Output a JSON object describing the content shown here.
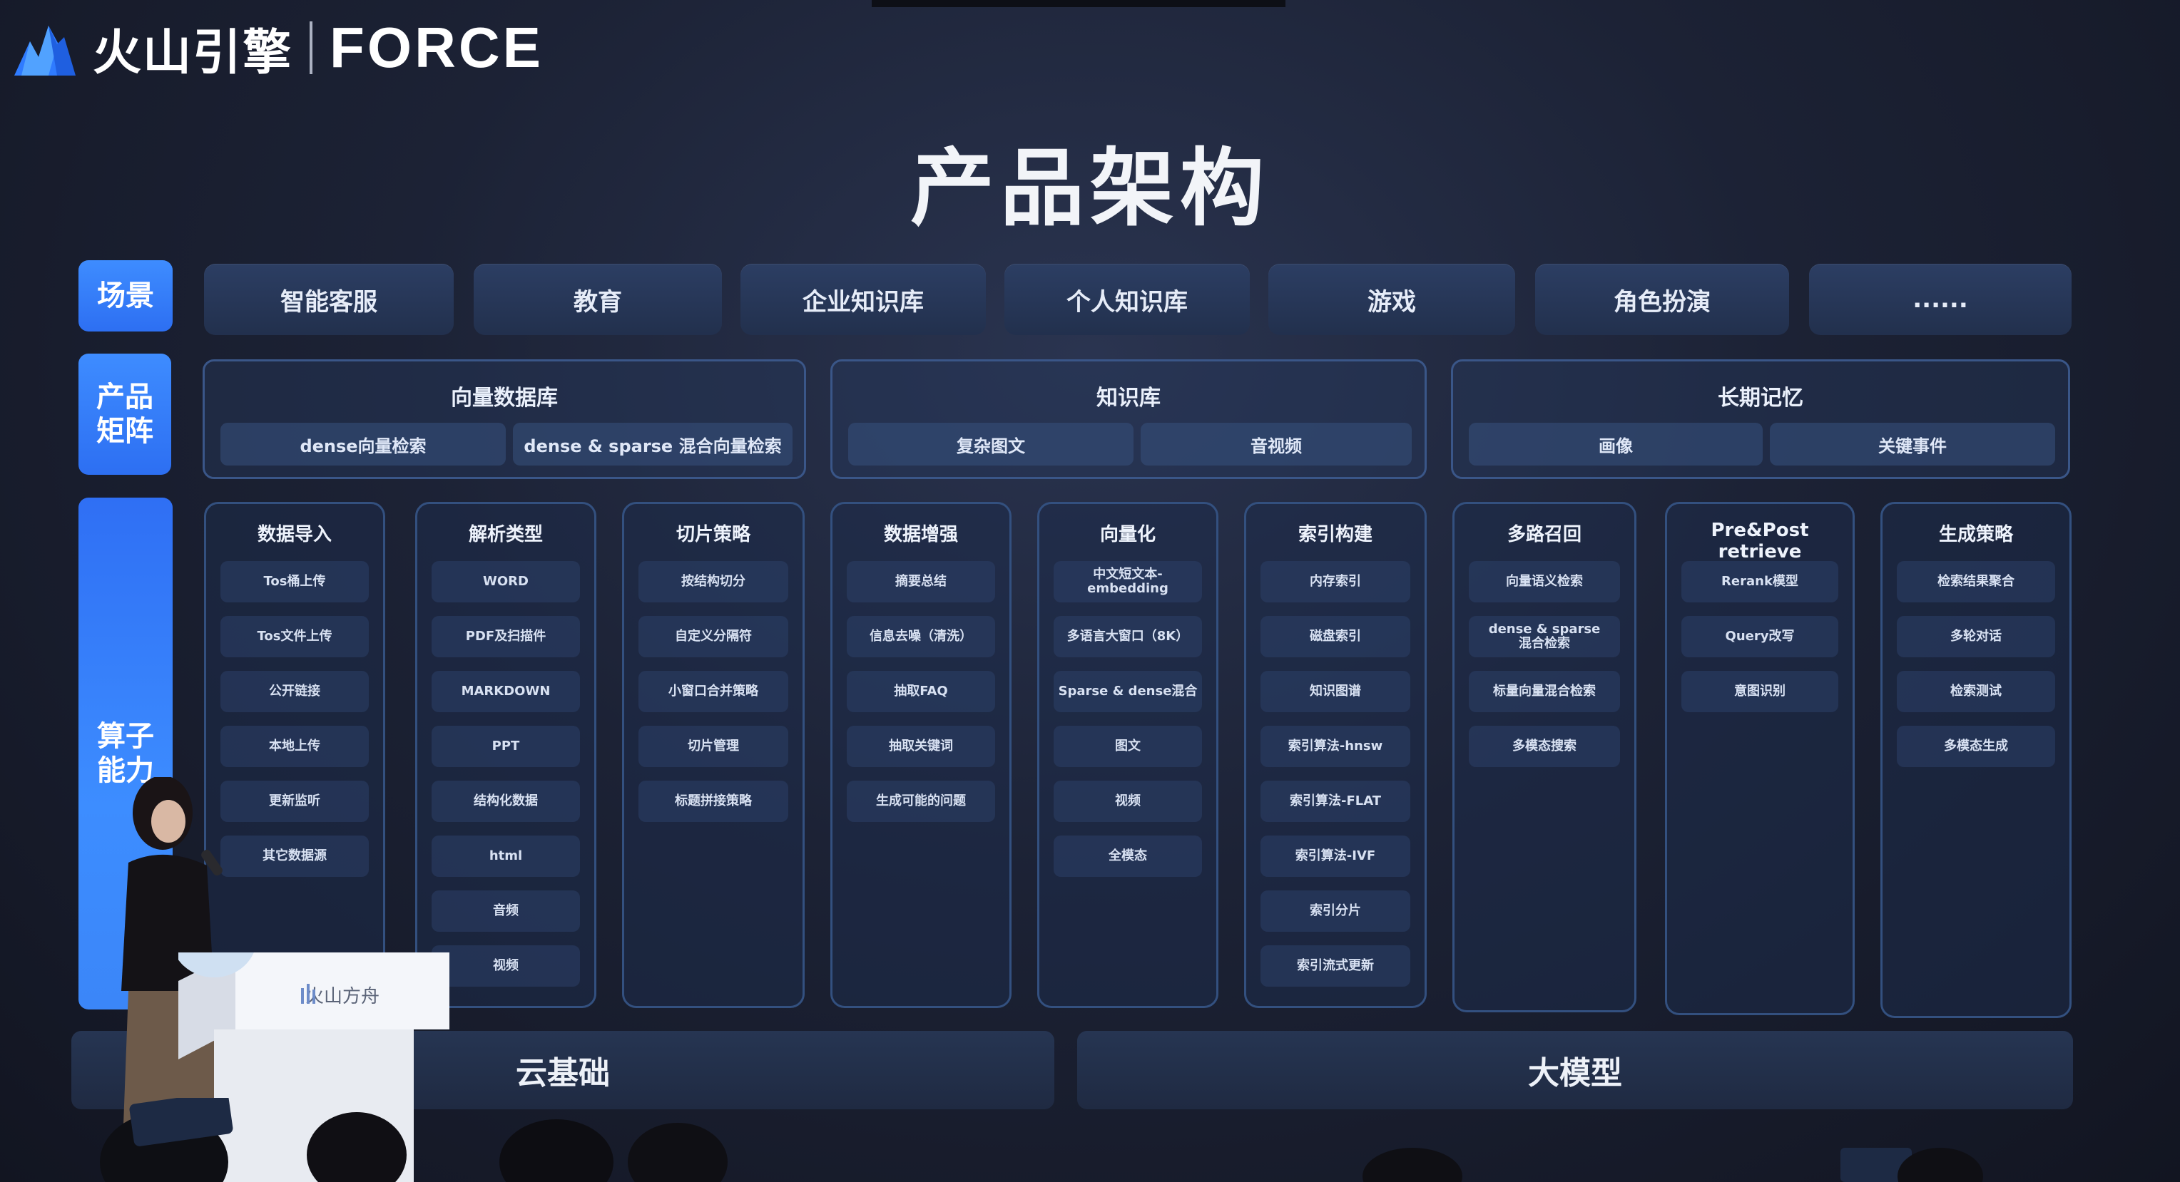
{
  "header": {
    "brand_cn": "火山引擎",
    "brand_en": "FORCE"
  },
  "title": "产品架构",
  "side_tags": {
    "scene": "场景",
    "matrix": "产品\n矩阵",
    "operator": "算子\n能力"
  },
  "scenes": [
    "智能客服",
    "教育",
    "企业知识库",
    "个人知识库",
    "游戏",
    "角色扮演",
    "......"
  ],
  "matrix": [
    {
      "title": "向量数据库",
      "subs": [
        "dense向量检索",
        "dense & sparse 混合向量检索"
      ]
    },
    {
      "title": "知识库",
      "subs": [
        "复杂图文",
        "音视频"
      ]
    },
    {
      "title": "长期记忆",
      "subs": [
        "画像",
        "关键事件"
      ]
    }
  ],
  "columns": [
    {
      "title": "数据导入",
      "items": [
        "Tos桶上传",
        "Tos文件上传",
        "公开链接",
        "本地上传",
        "更新监听",
        "其它数据源"
      ]
    },
    {
      "title": "解析类型",
      "items": [
        "WORD",
        "PDF及扫描件",
        "MARKDOWN",
        "PPT",
        "结构化数据",
        "html",
        "音频",
        "视频"
      ]
    },
    {
      "title": "切片策略",
      "items": [
        "按结构切分",
        "自定义分隔符",
        "小窗口合并策略",
        "切片管理",
        "标题拼接策略"
      ]
    },
    {
      "title": "数据增强",
      "items": [
        "摘要总结",
        "信息去噪（清洗）",
        "抽取FAQ",
        "抽取关键词",
        "生成可能的问题"
      ]
    },
    {
      "title": "向量化",
      "items": [
        "中文短文本-\nembedding",
        "多语言大窗口（8K）",
        "Sparse & dense混合",
        "图文",
        "视频",
        "全模态"
      ]
    },
    {
      "title": "索引构建",
      "items": [
        "内存索引",
        "磁盘索引",
        "知识图谱",
        "索引算法-hnsw",
        "索引算法-FLAT",
        "索引算法-IVF",
        "索引分片",
        "索引流式更新"
      ]
    },
    {
      "title": "多路召回",
      "items": [
        "向量语义检索",
        "dense & sparse\n混合检索",
        "标量向量混合检索",
        "多模态搜索"
      ]
    },
    {
      "title": "Pre&Post retrieve",
      "items": [
        "Rerank模型",
        "Query改写",
        "意图识别"
      ]
    },
    {
      "title": "生成策略",
      "items": [
        "检索结果聚合",
        "多轮对话",
        "检索测试",
        "多模态生成"
      ]
    }
  ],
  "base": [
    "云基础",
    "大模型"
  ],
  "podium_label": "火山方舟",
  "colors": {
    "accent": "#3d8dff",
    "background": "#1c2235",
    "panel": "#2c3e63"
  }
}
